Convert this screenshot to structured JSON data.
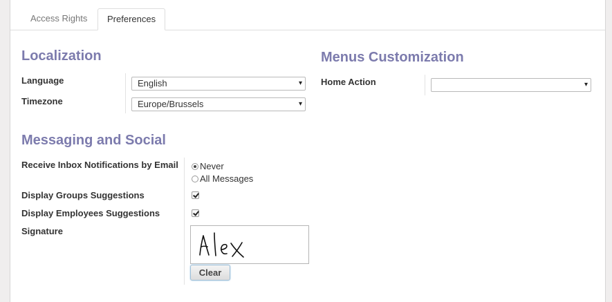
{
  "tabs": [
    {
      "label": "Access Rights",
      "active": false
    },
    {
      "label": "Preferences",
      "active": true
    }
  ],
  "localization": {
    "title": "Localization",
    "language_label": "Language",
    "language_value": "English",
    "timezone_label": "Timezone",
    "timezone_value": "Europe/Brussels"
  },
  "menus": {
    "title": "Menus Customization",
    "home_action_label": "Home Action",
    "home_action_value": ""
  },
  "messaging": {
    "title": "Messaging and Social",
    "inbox_label": "Receive Inbox Notifications by Email",
    "inbox_options": [
      {
        "label": "Never",
        "selected": true
      },
      {
        "label": "All Messages",
        "selected": false
      }
    ],
    "groups_label": "Display Groups Suggestions",
    "groups_checked": true,
    "employees_label": "Display Employees Suggestions",
    "employees_checked": true,
    "signature_label": "Signature",
    "signature_text": "Alex",
    "clear_label": "Clear"
  },
  "icons": {
    "select_caret": "▾"
  },
  "colors": {
    "section_title": "#7c7bad",
    "background": "#f0eeee",
    "sheet": "#ffffff"
  }
}
